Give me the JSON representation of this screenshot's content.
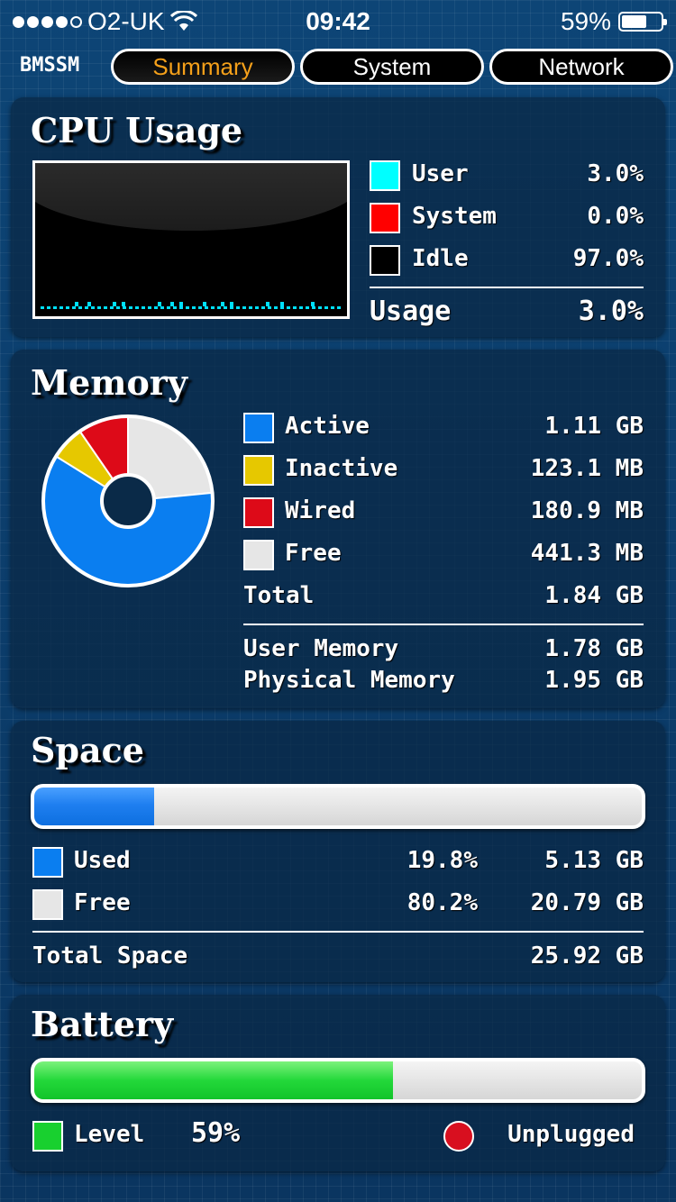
{
  "status_bar": {
    "carrier": "O2-UK",
    "time": "09:42",
    "battery_percent": "59%",
    "battery_level": 0.59
  },
  "nav": {
    "brand": "BMSSM",
    "tabs": [
      {
        "label": "Summary",
        "active": true
      },
      {
        "label": "System",
        "active": false
      },
      {
        "label": "Network",
        "active": false
      }
    ]
  },
  "cpu": {
    "title": "CPU Usage",
    "legend": [
      {
        "label": "User",
        "value": "3.0%",
        "color": "#00ffff"
      },
      {
        "label": "System",
        "value": "0.0%",
        "color": "#ff0000"
      },
      {
        "label": "Idle",
        "value": "97.0%",
        "color": "#000000"
      }
    ],
    "usage_label": "Usage",
    "usage_value": "3.0%"
  },
  "memory": {
    "title": "Memory",
    "legend": [
      {
        "label": "Active",
        "value": "1.11 GB",
        "color": "#0a7ef0"
      },
      {
        "label": "Inactive",
        "value": "123.1 MB",
        "color": "#e6c800"
      },
      {
        "label": "Wired",
        "value": "180.9 MB",
        "color": "#dd0a18"
      },
      {
        "label": "Free",
        "value": "441.3 MB",
        "color": "#e6e6e6"
      }
    ],
    "total_label": "Total",
    "total_value": "1.84 GB",
    "user_memory_label": "User Memory",
    "user_memory_value": "1.78 GB",
    "physical_memory_label": "Physical Memory",
    "physical_memory_value": "1.95 GB"
  },
  "space": {
    "title": "Space",
    "used_fraction": 0.198,
    "used_label": "Used",
    "used_percent": "19.8%",
    "used_value": "5.13 GB",
    "free_label": "Free",
    "free_percent": "80.2%",
    "free_value": "20.79 GB",
    "total_label": "Total Space",
    "total_value": "25.92 GB",
    "colors": {
      "used": "#0a7ef0",
      "free": "#e6e6e6"
    }
  },
  "battery": {
    "title": "Battery",
    "level_fraction": 0.59,
    "level_label": "Level",
    "level_value": "59%",
    "state": "Unplugged",
    "colors": {
      "level": "#18d02f",
      "state": "#d80f1f"
    }
  }
}
